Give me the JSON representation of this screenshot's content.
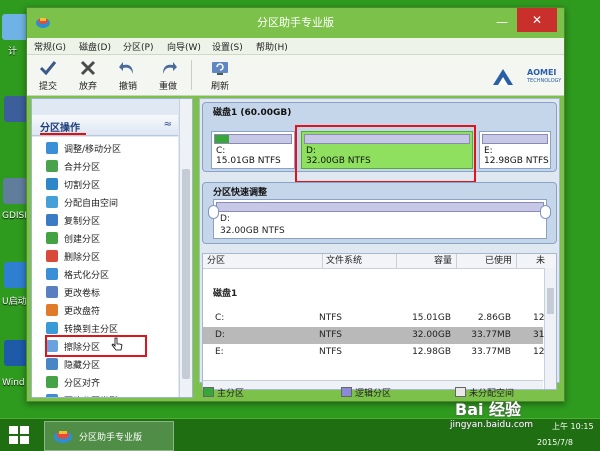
{
  "desktop": {
    "labels": [
      "计",
      "GDISK",
      "U启动",
      "Wind"
    ]
  },
  "window": {
    "title": "分区助手专业版",
    "minimize_glyph": "—",
    "close_glyph": "✕"
  },
  "menu": [
    "常规(G)",
    "磁盘(D)",
    "分区(P)",
    "向导(W)",
    "设置(S)",
    "帮助(H)"
  ],
  "toolbar": {
    "buttons": [
      "提交",
      "放弃",
      "撤销",
      "重做",
      "刷新"
    ],
    "logo_text": "AOMEI",
    "logo_sub": "TECHNOLOGY"
  },
  "left_panel": {
    "title": "分区操作",
    "collapse_glyph": "≈",
    "operations": [
      {
        "label": "调整/移动分区",
        "color": "#3a8fd6"
      },
      {
        "label": "合并分区",
        "color": "#4aa34a"
      },
      {
        "label": "切割分区",
        "color": "#2f86c8"
      },
      {
        "label": "分配自由空间",
        "color": "#46a0d8"
      },
      {
        "label": "复制分区",
        "color": "#3b7bc4"
      },
      {
        "label": "创建分区",
        "color": "#43a343"
      },
      {
        "label": "删除分区",
        "color": "#d84a3a"
      },
      {
        "label": "格式化分区",
        "color": "#3a8fd6"
      },
      {
        "label": "更改卷标",
        "color": "#5a7fc0"
      },
      {
        "label": "更改盘符",
        "color": "#e07b2a"
      },
      {
        "label": "转换到主分区",
        "color": "#3a9ad6"
      },
      {
        "label": "擦除分区",
        "color": "#6aa2e0"
      },
      {
        "label": "隐藏分区",
        "color": "#4a86c6"
      },
      {
        "label": "分区对齐",
        "color": "#46a246"
      },
      {
        "label": "更改分区类型",
        "color": "#3a8fd6"
      }
    ]
  },
  "disk_map": {
    "title": "磁盘1 (60.00GB)",
    "partitions": [
      {
        "letter": "C:",
        "desc": "15.01GB NTFS",
        "used_fraction": 0.19
      },
      {
        "letter": "D:",
        "desc": "32.00GB NTFS",
        "used_fraction": 0
      },
      {
        "letter": "E:",
        "desc": "12.98GB NTFS",
        "used_fraction": 0
      }
    ]
  },
  "quick_adjust": {
    "title": "分区快速调整",
    "letter": "D:",
    "desc": "32.00GB NTFS"
  },
  "table": {
    "headers": [
      "分区",
      "文件系统",
      "容量",
      "已使用",
      "未"
    ],
    "group": "磁盘1",
    "rows": [
      {
        "part": "C:",
        "fs": "NTFS",
        "cap": "15.01GB",
        "used": "2.86GB",
        "free": "12",
        "selected": false
      },
      {
        "part": "D:",
        "fs": "NTFS",
        "cap": "32.00GB",
        "used": "33.77MB",
        "free": "31",
        "selected": true
      },
      {
        "part": "E:",
        "fs": "NTFS",
        "cap": "12.98GB",
        "used": "33.77MB",
        "free": "12",
        "selected": false
      }
    ]
  },
  "legend": {
    "items": [
      {
        "label": "主分区",
        "color": "#39a639"
      },
      {
        "label": "逻辑分区",
        "color": "#8a8ad8"
      },
      {
        "label": "未分配空间",
        "color": "#e9e9e9"
      }
    ]
  },
  "taskbar": {
    "app_label": "分区助手专业版",
    "time": "上午 10:15",
    "date": "2015/7/8",
    "watermark": "Bai 经验",
    "watermark_url": "jingyan.baidu.com"
  }
}
